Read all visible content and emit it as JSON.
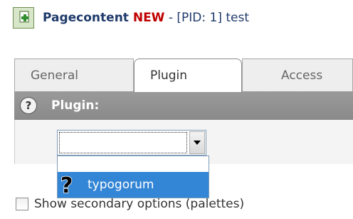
{
  "header": {
    "title_bold": "Pagecontent",
    "title_new": "NEW",
    "title_rest": " - [PID: 1] test"
  },
  "tabs": [
    {
      "label": "General",
      "active": false
    },
    {
      "label": "Plugin",
      "active": true
    },
    {
      "label": "Access",
      "active": false
    }
  ],
  "section": {
    "help_glyph": "?",
    "label": "Plugin:"
  },
  "plugin_select": {
    "value": "",
    "options": [
      {
        "label": ""
      },
      {
        "label": "typogorum",
        "selected": true,
        "icon": "question-mark-icon"
      }
    ]
  },
  "secondary_options": {
    "label": "Show secondary options (palettes)",
    "checked": false
  },
  "colors": {
    "title": "#1f3a6b",
    "new_badge": "#c00000",
    "section_bar": "#8f8f8f",
    "highlight": "#3385d6"
  }
}
